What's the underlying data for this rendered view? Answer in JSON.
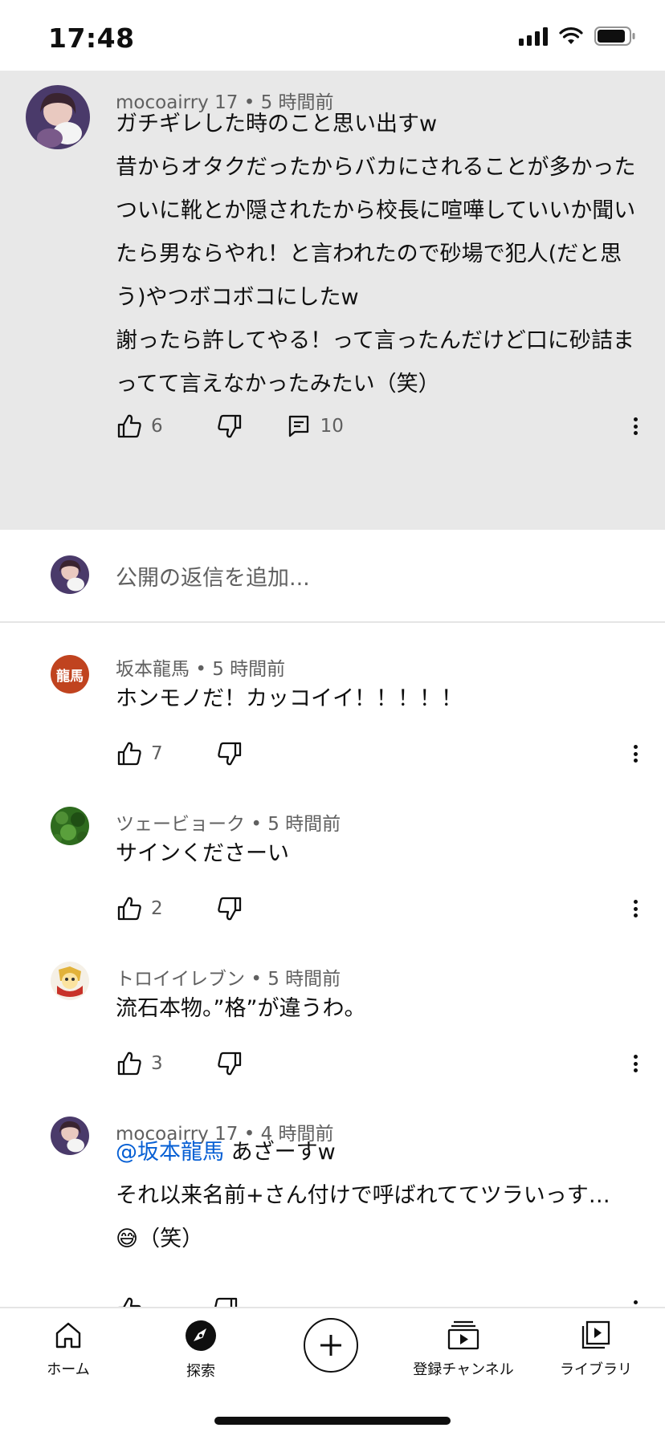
{
  "status_bar": {
    "time": "17:48"
  },
  "main_comment": {
    "author": "mocoairry 17",
    "time": "5 時間前",
    "lines": [
      "ガチギレした時のこと思い出すw",
      "昔からオタクだったからバカにされることが多かった",
      "ついに靴とか隠されたから校長に喧嘩していいか聞いたら男ならやれ！と言われたので砂場で犯人(だと思う)やつボコボコにしたw",
      "謝ったら許してやる！って言ったんだけど口に砂詰まってて言えなかったみたい（笑）"
    ],
    "likes": "6",
    "replies": "10"
  },
  "reply_input": {
    "placeholder": "公開の返信を追加..."
  },
  "replies": [
    {
      "author": "坂本龍馬",
      "time": "5 時間前",
      "text": "ホンモノだ！カッコイイ！！！！！",
      "likes": "7",
      "avatar_text": "龍馬",
      "avatar_color": "#c0431f"
    },
    {
      "author": "ツェービョーク",
      "time": "5 時間前",
      "text": "サインくださーい",
      "likes": "2",
      "avatar_color": "#2e6b1e"
    },
    {
      "author": "トロイイレブン",
      "time": "5 時間前",
      "text": "流石本物。”格”が違うわ。",
      "likes": "3",
      "avatar_color": "#d8a63a"
    },
    {
      "author": "mocoairry 17",
      "time": "4 時間前",
      "mention": "@坂本龍馬",
      "text_after_mention": " あざーすw",
      "line2": "それ以来名前+さん付けで呼ばれててツラいっす…",
      "line3_emoji": "😅",
      "line3_text": "（笑）"
    }
  ],
  "bottom_nav": {
    "home": "ホーム",
    "explore": "探索",
    "subscriptions": "登録チャンネル",
    "library": "ライブラリ"
  },
  "colors": {
    "highlight_bg": "#e8e8e8",
    "mention_blue": "#065fd4",
    "meta_gray": "#606060"
  }
}
